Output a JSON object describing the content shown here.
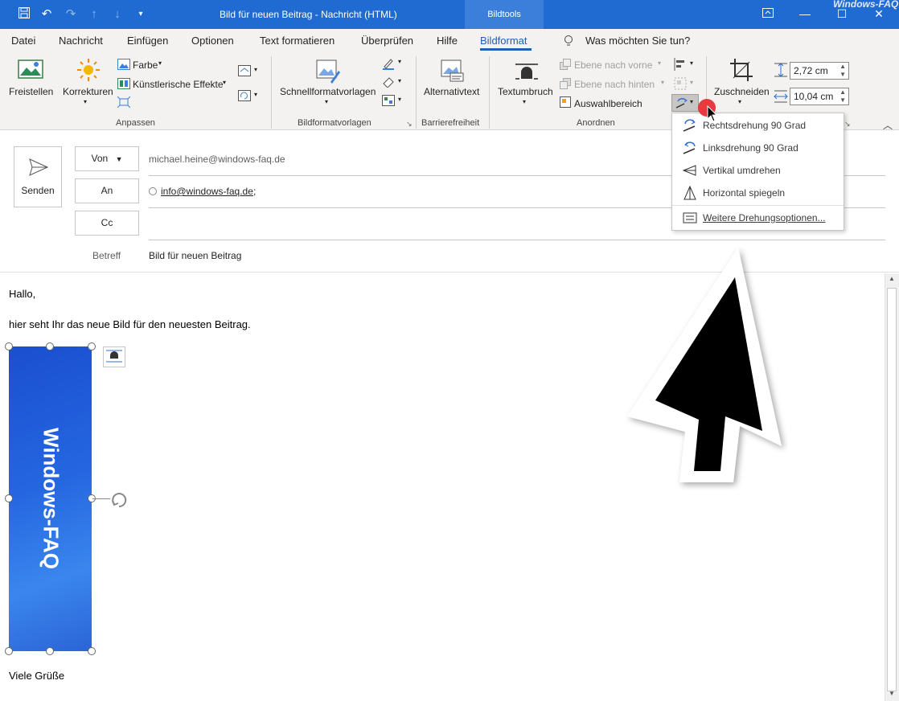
{
  "titlebar": {
    "title": "Bild für neuen Beitrag  -  Nachricht (HTML)",
    "context_tab": "Bildtools",
    "watermark": "Windows-FAQ"
  },
  "tabs": [
    "Datei",
    "Nachricht",
    "Einfügen",
    "Optionen",
    "Text formatieren",
    "Überprüfen",
    "Hilfe",
    "Bildformat"
  ],
  "tell_me": "Was möchten Sie tun?",
  "ribbon": {
    "freistellen": "Freistellen",
    "korrekturen": "Korrekturen",
    "farbe": "Farbe",
    "kuenstlerische": "Künstlerische Effekte",
    "group_anpassen": "Anpassen",
    "schnellformat": "Schnellformatvorlagen",
    "group_bildformat": "Bildformatvorlagen",
    "alternativtext": "Alternativtext",
    "group_barriere": "Barrierefreiheit",
    "textumbruch": "Textumbruch",
    "ebene_vorne": "Ebene nach vorne",
    "ebene_hinten": "Ebene nach hinten",
    "auswahlbereich": "Auswahlbereich",
    "group_anordnen": "Anordnen",
    "zuschneiden": "Zuschneiden",
    "height": "2,72 cm",
    "width": "10,04 cm"
  },
  "header": {
    "send": "Senden",
    "von": "Von",
    "from_address": "michael.heine@windows-faq.de",
    "an": "An",
    "to_address": "info@windows-faq.de",
    "to_sep": ";",
    "cc": "Cc",
    "betreff_label": "Betreff",
    "subject": "Bild für neuen Beitrag"
  },
  "body": {
    "greeting": "Hallo,",
    "line1": "hier seht Ihr das neue Bild für den neuesten Beitrag.",
    "image_text": "Windows-FAQ",
    "closing": "Viele Grüße"
  },
  "rotate_menu": {
    "items": [
      "Rechtsdrehung 90 Grad",
      "Linksdrehung 90 Grad",
      "Vertikal umdrehen",
      "Horizontal spiegeln",
      "Weitere Drehungsoptionen..."
    ]
  }
}
